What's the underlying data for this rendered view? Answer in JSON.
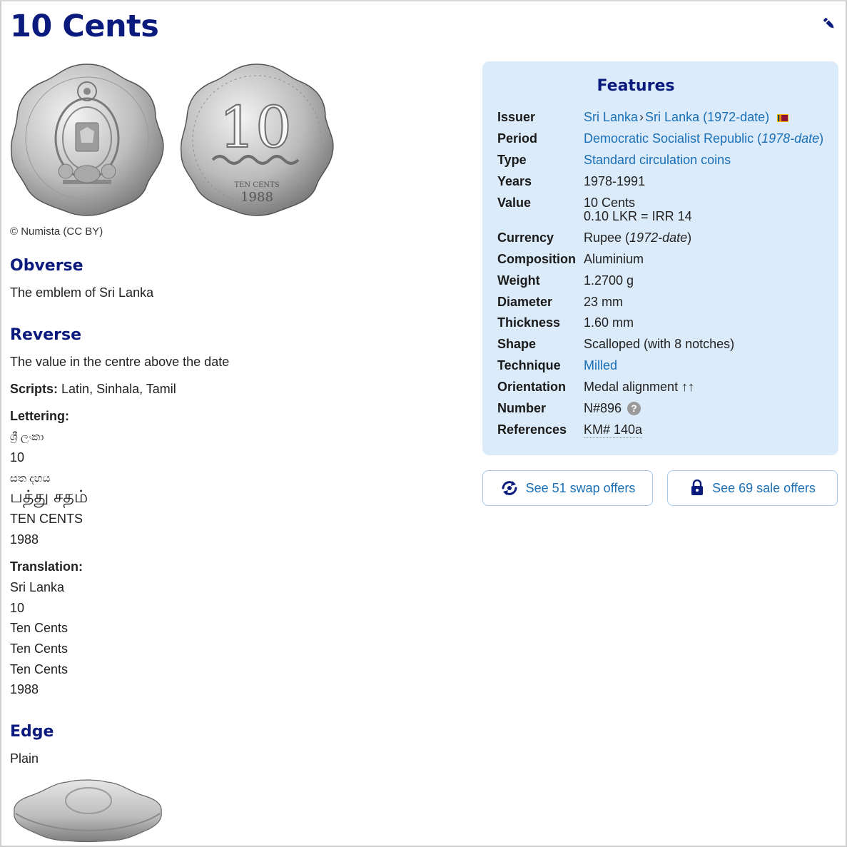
{
  "title": "10 Cents",
  "image_caption": "© Numista (CC BY)",
  "obverse": {
    "heading": "Obverse",
    "description": "The emblem of Sri Lanka"
  },
  "reverse": {
    "heading": "Reverse",
    "description": "The value in the centre above the date",
    "scripts_label": "Scripts:",
    "scripts_value": " Latin, Sinhala, Tamil",
    "lettering_label": "Lettering:",
    "lettering": [
      "ශ්‍රී ලංකා",
      "10",
      "සත දහය",
      "பத்து சதம்",
      "TEN CENTS",
      "1988"
    ],
    "translation_label": "Translation:",
    "translation": [
      "Sri Lanka",
      "10",
      "Ten Cents",
      "Ten Cents",
      "Ten Cents",
      "1988"
    ]
  },
  "edge": {
    "heading": "Edge",
    "description": "Plain"
  },
  "features": {
    "heading": "Features",
    "issuer_label": "Issuer",
    "issuer_parent": "Sri Lanka",
    "issuer_sep": "›",
    "issuer": "Sri Lanka (1972-date)",
    "period_label": "Period",
    "period": "Democratic Socialist Republic (",
    "period_dates": "1978-date",
    "period_close": ")",
    "type_label": "Type",
    "type": "Standard circulation coins",
    "years_label": "Years",
    "years": "1978-1991",
    "value_label": "Value",
    "value_line1": "10 Cents",
    "value_line2": "0.10 LKR = IRR 14",
    "currency_label": "Currency",
    "currency": "Rupee (",
    "currency_dates": "1972-date",
    "currency_close": ")",
    "composition_label": "Composition",
    "composition": "Aluminium",
    "weight_label": "Weight",
    "weight": "1.2700 g",
    "diameter_label": "Diameter",
    "diameter": "23 mm",
    "thickness_label": "Thickness",
    "thickness": "1.60 mm",
    "shape_label": "Shape",
    "shape": "Scalloped (with 8 notches)",
    "technique_label": "Technique",
    "technique": "Milled",
    "orientation_label": "Orientation",
    "orientation": "Medal alignment ↑↑",
    "number_label": "Number",
    "number": "N#896",
    "help_icon": "?",
    "references_label": "References",
    "references": "KM# 140a"
  },
  "buttons": {
    "swap": "See 51 swap offers",
    "sale": "See 69 sale offers"
  },
  "coin_obverse_lettering": {
    "value": "10",
    "word": "TEN CENTS",
    "year": "1988"
  },
  "colors": {
    "title": "#0b1a7d",
    "link": "#1a6fb5",
    "panel": "#dcebfa"
  }
}
